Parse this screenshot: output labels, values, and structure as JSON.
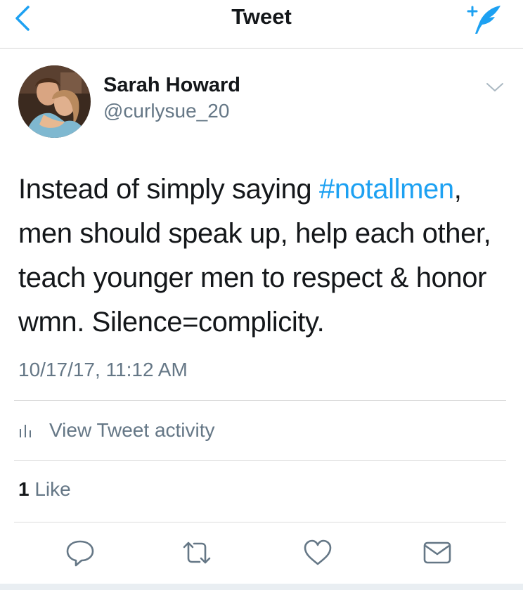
{
  "header": {
    "title": "Tweet",
    "back_icon": "chevron-left-icon",
    "compose_icon": "compose-tweet-icon",
    "accent_color": "#1da1f2"
  },
  "tweet": {
    "author": {
      "display_name": "Sarah Howard",
      "handle": "@curlysue_20"
    },
    "text": {
      "before_hashtag": "Instead of simply saying ",
      "hashtag": "#notallmen",
      "after_hashtag": ", men should speak up, help each other, teach younger men to respect & honor wmn. Silence=complicity."
    },
    "timestamp": "10/17/17, 11:12 AM",
    "activity_label": "View Tweet activity",
    "likes": {
      "count": "1",
      "label": "Like"
    }
  },
  "actions": {
    "icons": [
      "reply-icon",
      "retweet-icon",
      "like-icon",
      "direct-message-icon"
    ]
  }
}
